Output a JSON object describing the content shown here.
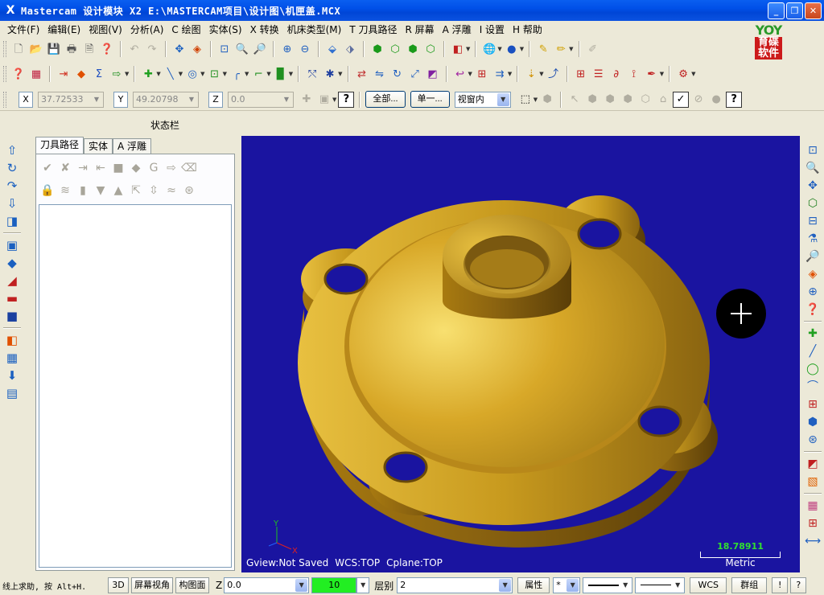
{
  "window": {
    "app_glyph": "X",
    "title": "Mastercam 设计模块  X2  E:\\MASTERCAM项目\\设计图\\机匣盖.MCX",
    "minimize": "_",
    "restore": "❐",
    "close": "✕"
  },
  "menu": [
    "文件(F)",
    "编辑(E)",
    "视图(V)",
    "分析(A)",
    "C 绘图",
    "实体(S)",
    "X 转换",
    "机床类型(M)",
    "T 刀具路径",
    "R 屏幕",
    "A 浮雕",
    "I 设置",
    "H 帮助"
  ],
  "logo": {
    "glyph": "YOY",
    "text": "育碟软件"
  },
  "coords": {
    "x_label": "X",
    "x_value": "37.72533",
    "y_label": "Y",
    "y_value": "49.20798",
    "z_label": "Z",
    "z_value": "0.0"
  },
  "selection": {
    "all_button": "全部...",
    "single_button": "单一...",
    "mode_value": "视窗内"
  },
  "status_label": "状态栏",
  "panel": {
    "tabs": [
      "刀具路径",
      "实体",
      "A 浮雕"
    ],
    "active_tab": 0
  },
  "viewport": {
    "gview": "Gview:Not Saved",
    "wcs": "WCS:TOP",
    "cplane": "Cplane:TOP",
    "scale_value": "18.78911",
    "scale_unit": "Metric",
    "axis_y": "Y",
    "axis_x": "X",
    "background_color": "#1a14a0",
    "part_color": "#c89a1e"
  },
  "bottom": {
    "help_text": "线上求助, 按 Alt+H.",
    "btn_3d": "3D",
    "btn_screen_view": "屏幕视角",
    "btn_cplane": "构图面",
    "z_label": "Z",
    "z_value": "0.0",
    "color_value": "10",
    "level_label": "层别",
    "level_value": "2",
    "attributes_button": "属性",
    "point_style": "*",
    "wcs_button": "WCS",
    "group_button": "群组",
    "help_button": "!",
    "question_button": "?"
  }
}
